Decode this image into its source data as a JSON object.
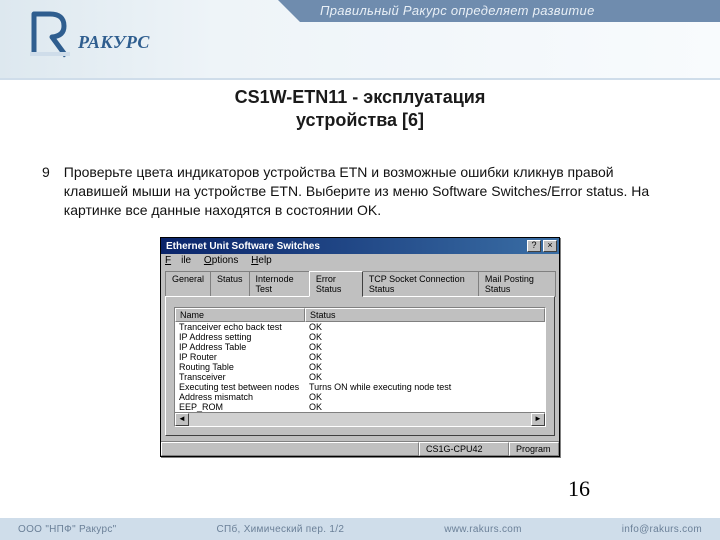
{
  "banner": {
    "slogan": "Правильный Ракурс определяет развитие",
    "brand": "РАКУРС"
  },
  "title": {
    "line1": "CS1W-ETN11 - эксплуатация",
    "line2": "устройства [6]"
  },
  "step": {
    "num": "9",
    "text": "Проверьте цвета индикаторов устройства ETN и возможные ошибки кликнув правой клавишей мыши на устройстве ETN. Выберите из меню  Software Switches/Error status. На картинке все данные находятся в состоянии OK."
  },
  "dialog": {
    "title": "Ethernet Unit Software Switches",
    "menu": {
      "file": "File",
      "options": "Options",
      "help": "Help"
    },
    "tabs": [
      "General",
      "Status",
      "Internode Test",
      "Error Status",
      "TCP Socket Connection Status",
      "Mail Posting Status"
    ],
    "active_tab": 3,
    "columns": {
      "name": "Name",
      "status": "Status"
    },
    "rows": [
      {
        "name": "Tranceiver echo back test",
        "status": "OK"
      },
      {
        "name": "IP Address setting",
        "status": "OK"
      },
      {
        "name": "IP Address Table",
        "status": "OK"
      },
      {
        "name": "IP Router",
        "status": "OK"
      },
      {
        "name": "Routing Table",
        "status": "OK"
      },
      {
        "name": "Transceiver",
        "status": "OK"
      },
      {
        "name": "Executing test between nodes",
        "status": "Turns ON while executing node test"
      },
      {
        "name": "Address mismatch",
        "status": "OK"
      },
      {
        "name": "EEP_ROM",
        "status": "OK"
      }
    ],
    "statusbar": {
      "cpu": "CS1G-CPU42",
      "mode": "Program"
    }
  },
  "page_number": "16",
  "footer": {
    "company": "ООО \"НПФ\" Ракурс\"",
    "address": "СПб, Химический пер. 1/2",
    "site": "www.rakurs.com",
    "email": "info@rakurs.com"
  }
}
